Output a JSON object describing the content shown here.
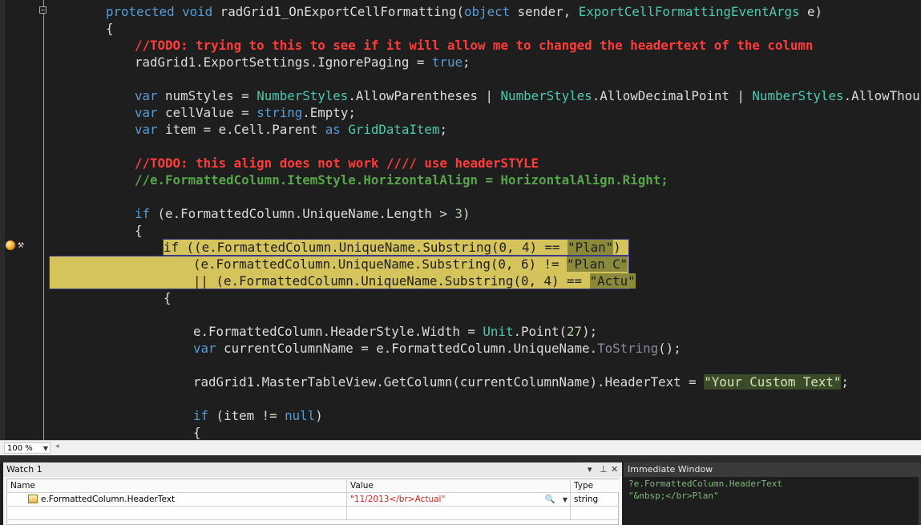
{
  "code_lines": {
    "l0": {
      "kw1": "protected",
      "kw2": "void",
      "name": " radGrid1_OnExportCellFormatting(",
      "t1": "object",
      "p1": " sender, ",
      "t2": "ExportCellFormattingEventArgs",
      "p2": " e)"
    },
    "l1": "{",
    "l2_todo": "//TODO: trying to this to see if it will allow me to changed the headertext of the column",
    "l3": {
      "a": "radGrid1.ExportSettings.IgnorePaging = ",
      "kw": "true",
      "b": ";"
    },
    "l5": {
      "kw": "var",
      "a": " numStyles = ",
      "t1": "NumberStyles",
      "a2": ".AllowParentheses | ",
      "t2": "NumberStyles",
      "a3": ".AllowDecimalPoint | ",
      "t3": "NumberStyles",
      "a4": ".AllowThousands;"
    },
    "l6": {
      "kw": "var",
      "a": " cellValue = ",
      "kw2": "string",
      "b": ".Empty;"
    },
    "l7": {
      "kw": "var",
      "a": " item = e.Cell.Parent ",
      "kw2": "as",
      "sp": " ",
      "t": "GridDataItem",
      "b": ";"
    },
    "l9_todo": "//TODO: this align does not work //// use headerSTYLE",
    "l10_comment": "//e.FormattedColumn.ItemStyle.HorizontalAlign = HorizontalAlign.Right;",
    "l12": {
      "kw": "if",
      "a": " (e.FormattedColumn.UniqueName.Length > ",
      "num": "3",
      "b": ")"
    },
    "l13": "{",
    "l14": {
      "kw": "if",
      "a": " ((e.FormattedColumn.UniqueName.Substring(0, 4) == ",
      "s": "\"Plan\"",
      "b": ") &&"
    },
    "l15": {
      "a": "(e.FormattedColumn.UniqueName.Substring(0, 6) != ",
      "s": "\"Plan C\"",
      "b": ")"
    },
    "l16": {
      "a": "|| (e.FormattedColumn.UniqueName.Substring(0, 4) == ",
      "s": "\"Actu\"",
      "b": "))"
    },
    "l17": "{",
    "l19": {
      "a": "e.FormattedColumn.HeaderStyle.Width = ",
      "t": "Unit",
      "b": ".Point(",
      "num": "27",
      "c": ");"
    },
    "l20": {
      "kw": "var",
      "a": " currentColumnName = e.FormattedColumn.UniqueName.",
      "m": "ToString",
      "b": "();"
    },
    "l22": {
      "a": "radGrid1.MasterTableView.GetColumn(currentColumnName).HeaderText = ",
      "s": "\"Your Custom Text\"",
      "b": ";"
    },
    "l24": {
      "kw": "if",
      "a": " (item != ",
      "kw2": "null",
      "b": ")"
    },
    "l25": "{"
  },
  "zoom": "100 %",
  "watch": {
    "title": "Watch 1",
    "buttons": {
      "dropdown": "▾",
      "pin": "⊥",
      "close": "✕"
    },
    "headers": {
      "name": "Name",
      "value": "Value",
      "type": "Type"
    },
    "rows": [
      {
        "name": "e.FormattedColumn.HeaderText",
        "value": "\"11/2013</br>Actual\"",
        "type": "string"
      }
    ]
  },
  "immediate": {
    "title": "Immediate Window",
    "lines": [
      "?e.FormattedColumn.HeaderText",
      "\"&nbsp;</br>Plan\""
    ]
  },
  "colors": {
    "keyword": "#569cd6",
    "type": "#4ec9b0",
    "comment": "#57a64a",
    "todo": "#ff3b3b",
    "highlight": "#d5c35c"
  }
}
